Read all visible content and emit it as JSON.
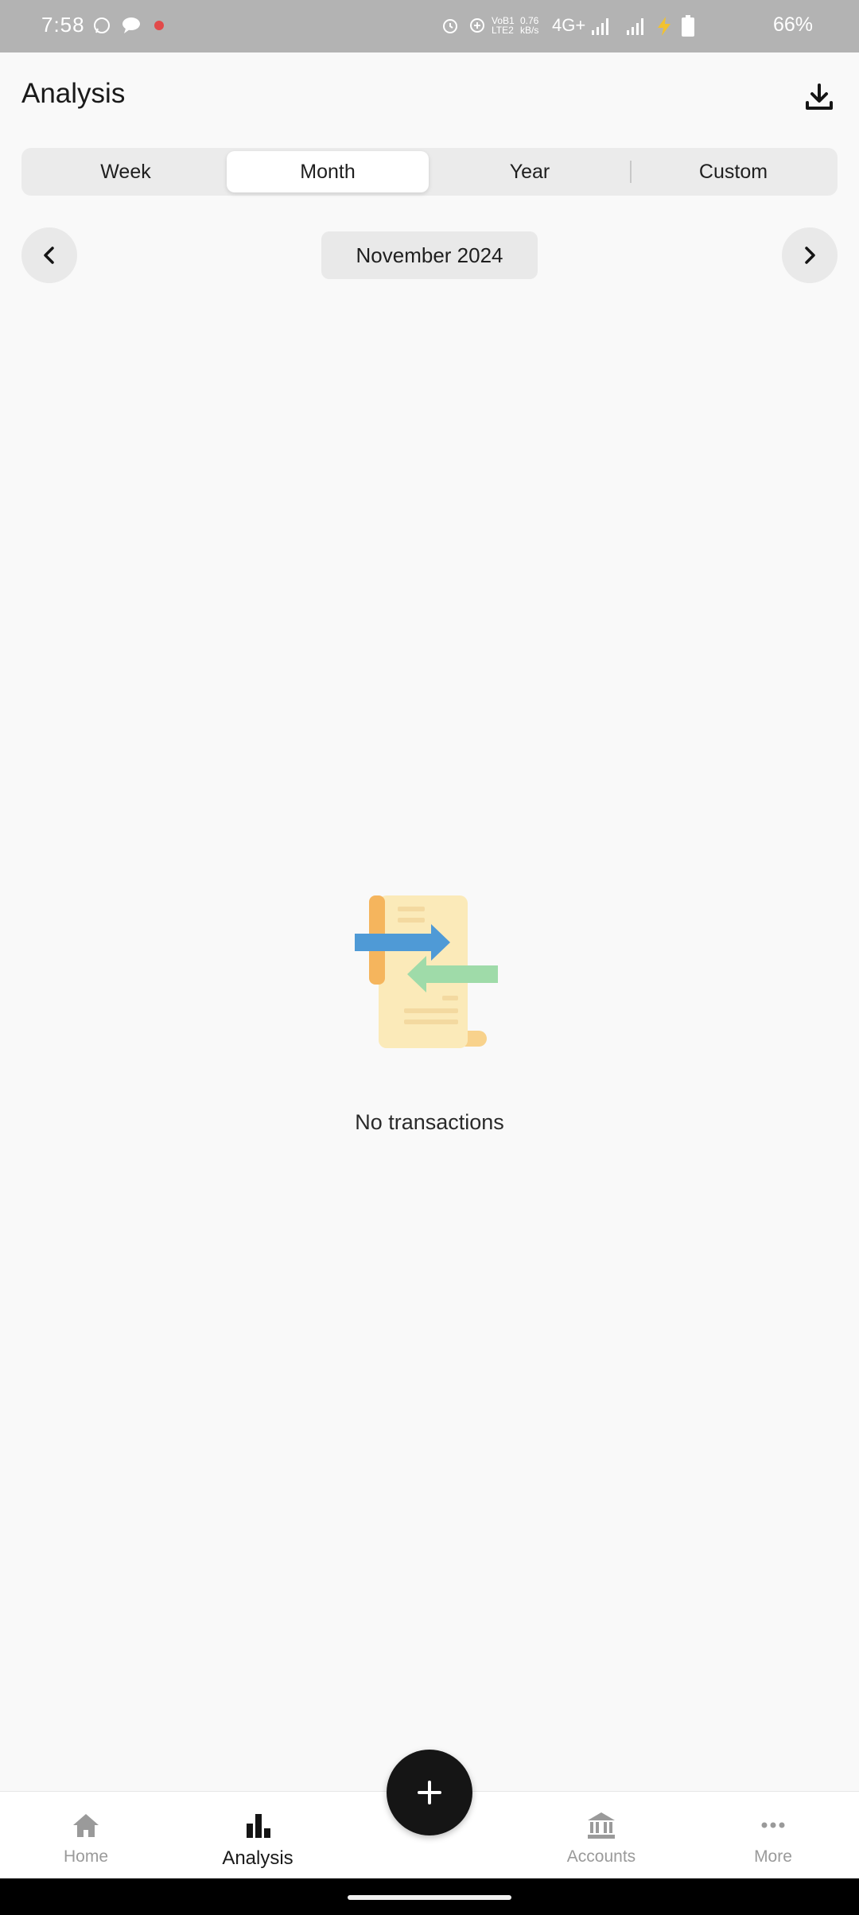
{
  "status_bar": {
    "time": "7:58",
    "network": "4G+",
    "volte": "VoB1 LTE2",
    "speed": "0.76 kB/s",
    "battery": "66%"
  },
  "header": {
    "title": "Analysis",
    "download_icon": "download-icon"
  },
  "segments": {
    "week": "Week",
    "month": "Month",
    "year": "Year",
    "custom": "Custom",
    "selected": "Month"
  },
  "period": {
    "label": "November 2024",
    "prev_icon": "chevron-left-icon",
    "next_icon": "chevron-right-icon"
  },
  "empty_state": {
    "message": "No transactions",
    "illustration": "transactions-illustration"
  },
  "fab": {
    "icon": "plus-icon"
  },
  "bottom_nav": {
    "home": "Home",
    "analysis": "Analysis",
    "accounts": "Accounts",
    "more": "More",
    "active": "Analysis"
  },
  "colors": {
    "background": "#f9f9f9",
    "accent": "#151515",
    "inactive": "#9a9a9a",
    "status_bar": "#b3b3b3"
  }
}
